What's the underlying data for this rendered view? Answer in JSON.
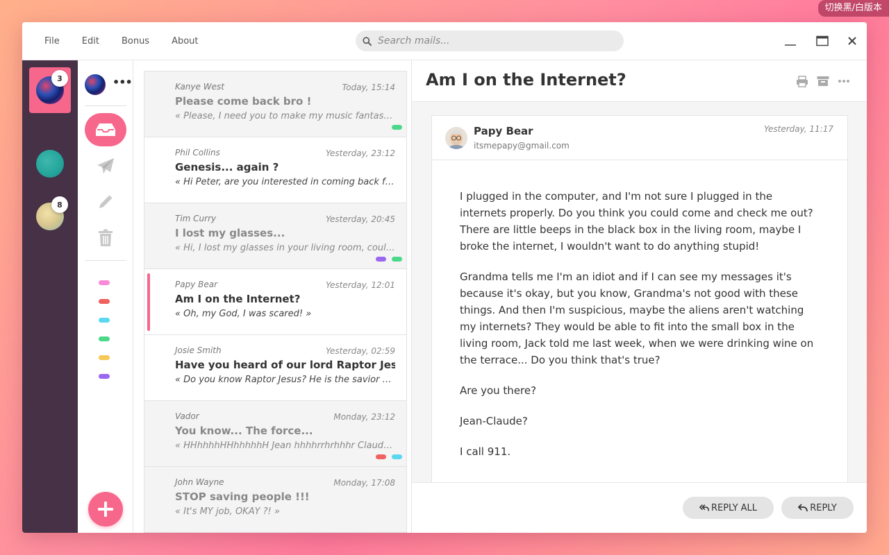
{
  "theme_toggle": "切换黑/白版本",
  "menu": {
    "file": "File",
    "edit": "Edit",
    "bonus": "Bonus",
    "about": "About"
  },
  "search": {
    "placeholder": "Search mails..."
  },
  "accounts": [
    {
      "badge": "3"
    },
    {
      "badge": ""
    },
    {
      "badge": "8"
    }
  ],
  "colors": {
    "accent": "#f7678b",
    "sidebar": "#463147"
  },
  "labels": [
    "#fa8ad8",
    "#f0615f",
    "#5bd7ef",
    "#4cd88a",
    "#f6c858",
    "#9a68f0"
  ],
  "mails": [
    {
      "from": "Kanye West",
      "date": "Today, 15:14",
      "subject": "Please come back bro !",
      "preview": "« Please, I need you to make my music fantastic again »",
      "read": true,
      "tags": [
        "#4cd88a"
      ]
    },
    {
      "from": "Phil Collins",
      "date": "Yesterday, 23:12",
      "subject": "Genesis... again ?",
      "preview": "« Hi Peter, are you interested in coming back for a reunion tour ? »",
      "read": false,
      "tags": []
    },
    {
      "from": "Tim Curry",
      "date": "Yesterday, 20:45",
      "subject": "I lost my glasses...",
      "preview": "« Hi, I lost my glasses in your living room, could you check ? »",
      "read": true,
      "tags": [
        "#9a68f0",
        "#4cd88a"
      ]
    },
    {
      "from": "Papy Bear",
      "date": "Yesterday, 12:01",
      "subject": "Am I on the Internet?",
      "preview": "« Oh, my God, I was scared! »",
      "read": false,
      "selected": true,
      "tags": []
    },
    {
      "from": "Josie Smith",
      "date": "Yesterday, 02:59",
      "subject": "Have you heard of our lord Raptor Jesus?",
      "preview": "« Do you know Raptor Jesus? He is the savior of all of us »",
      "read": false,
      "tags": []
    },
    {
      "from": "Vador",
      "date": "Monday, 23:12",
      "subject": "You know... The force...",
      "preview": "« HHhhhhHHhhhhhH Jean hhhhrrhrhhhr Claude hhhhrrrr »",
      "read": true,
      "tags": [
        "#f0615f",
        "#5bd7ef"
      ]
    },
    {
      "from": "John Wayne",
      "date": "Monday, 17:08",
      "subject": "STOP saving people !!!",
      "preview": "« It's MY job, OKAY ?! »",
      "read": true,
      "tags": []
    }
  ],
  "reader": {
    "title": "Am I on the Internet?",
    "sender_name": "Papy Bear",
    "sender_email": "itsmepapy@gmail.com",
    "date": "Yesterday, 11:17",
    "paragraphs": [
      "I plugged in the computer, and I'm not sure I plugged in the internets properly. Do you think you could come and check me out? There are little beeps in the black box in the living room, maybe I broke the internet, I wouldn't want to do anything stupid!",
      "Grandma tells me I'm an idiot and if I can see my messages it's because it's okay, but you know, Grandma's not good with these things. And then I'm suspicious, maybe the aliens aren't watching my internets? They would be able to fit into the small box in the living room, Jack told me last week, when we were drinking wine on the terrace... Do you think that's true?",
      "Are you there?",
      "Jean-Claude?",
      "I call 911."
    ],
    "reply_all": "REPLY ALL",
    "reply": "REPLY"
  }
}
